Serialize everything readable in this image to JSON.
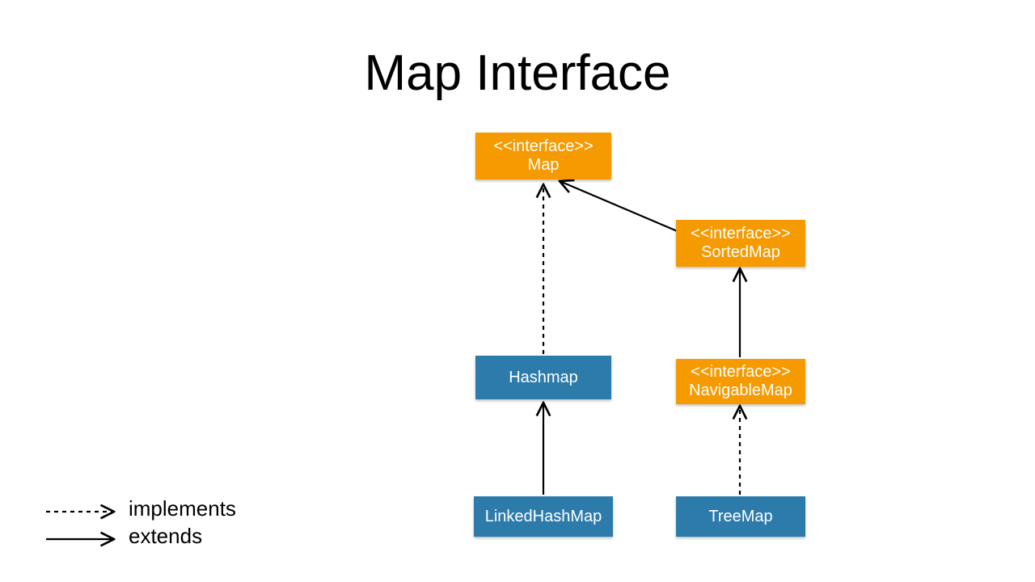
{
  "title": "Map Interface",
  "nodes": {
    "map": {
      "stereotype": "<<interface>>",
      "name": "Map",
      "kind": "interface"
    },
    "sortedmap": {
      "stereotype": "<<interface>>",
      "name": "SortedMap",
      "kind": "interface"
    },
    "navigablemap": {
      "stereotype": "<<interface>>",
      "name": "NavigableMap",
      "kind": "interface"
    },
    "hashmap": {
      "stereotype": "",
      "name": "Hashmap",
      "kind": "class"
    },
    "linkedhashmap": {
      "stereotype": "",
      "name": "LinkedHashMap",
      "kind": "class"
    },
    "treemap": {
      "stereotype": "",
      "name": "TreeMap",
      "kind": "class"
    }
  },
  "edges": [
    {
      "from": "hashmap",
      "to": "map",
      "relation": "implements"
    },
    {
      "from": "sortedmap",
      "to": "map",
      "relation": "extends"
    },
    {
      "from": "navigablemap",
      "to": "sortedmap",
      "relation": "extends"
    },
    {
      "from": "linkedhashmap",
      "to": "hashmap",
      "relation": "extends"
    },
    {
      "from": "treemap",
      "to": "navigablemap",
      "relation": "implements"
    }
  ],
  "legend": {
    "implements": "implements",
    "extends": "extends"
  },
  "colors": {
    "interface": "#f59a00",
    "class": "#2c7bab"
  }
}
